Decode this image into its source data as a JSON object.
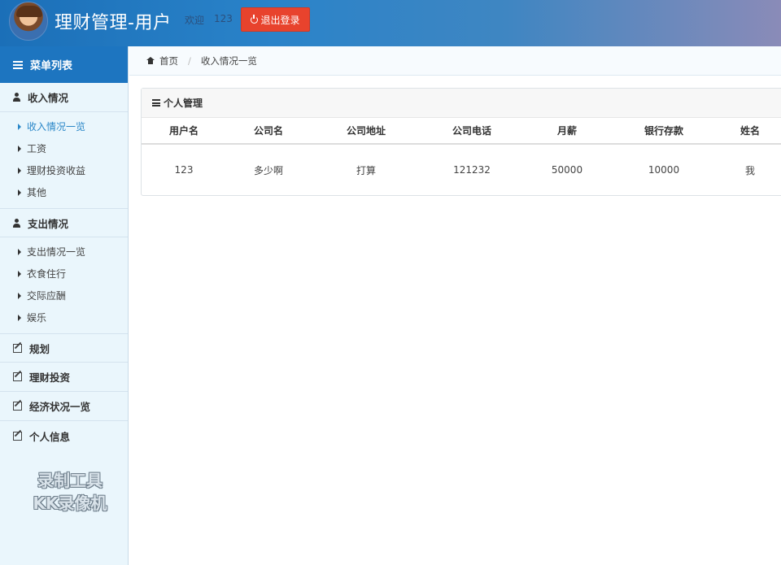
{
  "header": {
    "title": "理财管理-用户",
    "welcome": "欢迎",
    "username": "123",
    "logout_label": "退出登录"
  },
  "sidebar": {
    "menu_title": "菜单列表",
    "sections": [
      {
        "label": "收入情况",
        "icon": "user-icon",
        "items": [
          "收入情况一览",
          "工资",
          "理财投资收益",
          "其他"
        ],
        "active": 0
      },
      {
        "label": "支出情况",
        "icon": "user-icon",
        "items": [
          "支出情况一览",
          "衣食住行",
          "交际应酬",
          "娱乐"
        ]
      },
      {
        "label": "规划",
        "icon": "edit-icon"
      },
      {
        "label": "理财投资",
        "icon": "edit-icon"
      },
      {
        "label": "经济状况一览",
        "icon": "edit-icon"
      },
      {
        "label": "个人信息",
        "icon": "edit-icon"
      }
    ],
    "watermark": [
      "录制工具",
      "KK录像机"
    ]
  },
  "breadcrumb": {
    "home": "首页",
    "current": "收入情况一览"
  },
  "panel": {
    "title": "个人管理",
    "columns": [
      "用户名",
      "公司名",
      "公司地址",
      "公司电话",
      "月薪",
      "银行存款",
      "姓名"
    ],
    "rows": [
      [
        "123",
        "多少啊",
        "打算",
        "121232",
        "50000",
        "10000",
        "我"
      ]
    ]
  },
  "colors": {
    "header_blue": "#1b6fb8",
    "menu_blue": "#1d75c0",
    "logout_red": "#e8432d",
    "sidebar_bg": "#eaf6fc",
    "active_link": "#2a87c8"
  }
}
